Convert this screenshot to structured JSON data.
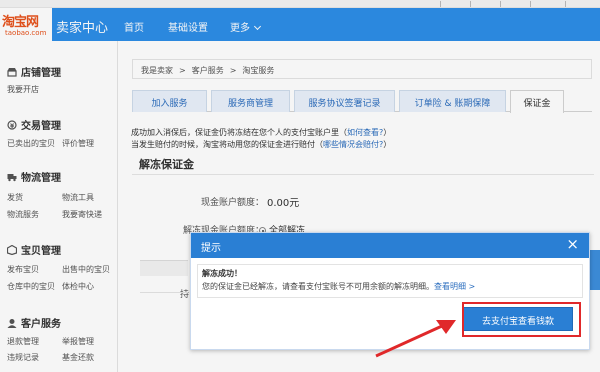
{
  "header": {
    "logo_main": "淘宝网",
    "logo_sub": "taobao.com",
    "seller_center": "卖家中心",
    "nav": [
      "首页",
      "基础设置",
      "更多"
    ]
  },
  "sidebar": {
    "sections": [
      {
        "title": "店铺管理",
        "items": [
          "我要开店"
        ]
      },
      {
        "title": "交易管理",
        "items": [
          "已卖出的宝贝",
          "评价管理"
        ]
      },
      {
        "title": "物流管理",
        "items": [
          "发货",
          "物流工具",
          "物流服务",
          "我要寄快递"
        ]
      },
      {
        "title": "宝贝管理",
        "items": [
          "发布宝贝",
          "出售中的宝贝",
          "仓库中的宝贝",
          "体检中心"
        ]
      },
      {
        "title": "客户服务",
        "items": [
          "退款管理",
          "举报管理",
          "违规记录",
          "基金还款"
        ]
      }
    ]
  },
  "breadcrumb": [
    "我是卖家",
    ">",
    "客户服务",
    ">",
    "淘宝服务"
  ],
  "tabs": [
    "加入服务",
    "服务商管理",
    "服务协议签署记录",
    "订单险 & 账期保障",
    "保证金"
  ],
  "info": {
    "line1_text": "成功加入消保后，保证金仍将冻结在您个人的支付宝账户里（",
    "line1_link": "如何查看?",
    "line1_end": "）",
    "line2_text": "当发生赔付的时候，淘宝将动用您的保证金进行赔付（",
    "line2_link": "哪些情况会赔付?",
    "line2_end": "）"
  },
  "section": {
    "title": "解冻保证金",
    "balance_label": "现金账户额度：",
    "balance_value": "0.00元",
    "unfreeze_label": "解冻现金账户额度：",
    "unfreeze_option": "全部解冻",
    "partial_label": "持"
  },
  "dialog": {
    "title": "提示",
    "close": "×",
    "msg1": "解冻成功！",
    "msg2": "您的保证金已经解冻，请查看支付宝账号不可用余额的解冻明细。",
    "msg2_link": "查看明细 >",
    "button": "去支付宝查看钱款"
  },
  "colors": {
    "header_blue": "#2d8ee8",
    "dialog_blue": "#2a7fd4",
    "highlight_red": "#e0282a",
    "link_blue": "#2d6fbf",
    "logo_orange": "#e8541e"
  }
}
